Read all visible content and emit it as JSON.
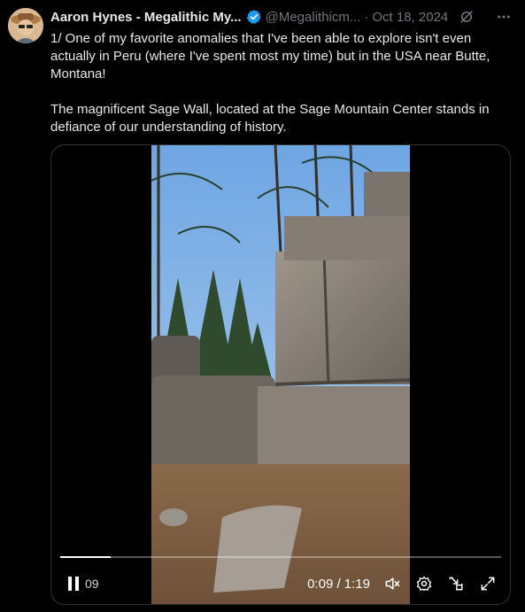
{
  "author": {
    "name": "Aaron Hynes - Megalithic My...",
    "handle": "@Megalithicm...",
    "separator": "·",
    "date": "Oct 18, 2024"
  },
  "text": {
    "line1": "1/ One of my favorite anomalies that I've been able to explore isn't even actually in Peru (where I've spent most my time) but in the USA near Butte, Montana!",
    "line2": "The magnificent Sage Wall, located at the Sage Mountain Center stands in defiance of our understanding of history."
  },
  "video": {
    "elapsed_overlay": "09",
    "time": "0:09 / 1:19",
    "progress": 0.114
  },
  "icons": {
    "verified": "verified-badge-icon",
    "grok": "grok-icon",
    "more": "more-icon",
    "pause": "pause-icon",
    "mute": "volume-muted-icon",
    "settings": "gear-icon",
    "pip": "picture-in-picture-icon",
    "fullscreen": "fullscreen-icon"
  },
  "colors": {
    "background": "#000000",
    "text": "#e7e9ea",
    "secondary": "#71767b",
    "verified": "#1d9bf0",
    "border": "#2f3336"
  }
}
